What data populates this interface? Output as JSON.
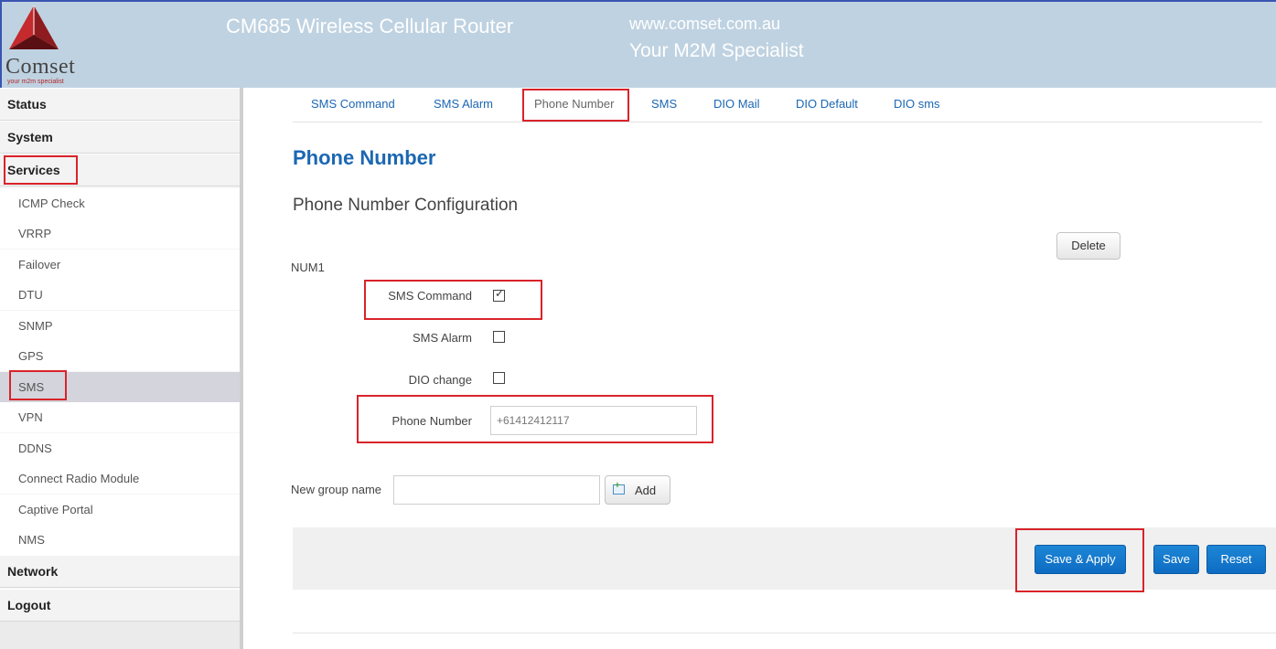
{
  "header": {
    "logo_text": "Comset",
    "logo_sub": "your m2m specialist",
    "title": "CM685 Wireless Cellular Router",
    "url": "www.comset.com.au",
    "tagline": "Your M2M Specialist"
  },
  "sidebar": {
    "status": "Status",
    "system": "System",
    "services": "Services",
    "items": [
      "ICMP Check",
      "VRRP",
      "Failover",
      "DTU",
      "SNMP",
      "GPS",
      "SMS",
      "VPN",
      "DDNS",
      "Connect Radio Module",
      "Captive Portal",
      "NMS"
    ],
    "active_item": "SMS",
    "network": "Network",
    "logout": "Logout"
  },
  "tabs": [
    "SMS Command",
    "SMS Alarm",
    "Phone Number",
    "SMS",
    "DIO Mail",
    "DIO Default",
    "DIO sms"
  ],
  "active_tab": "Phone Number",
  "main": {
    "page_title": "Phone Number",
    "section_title": "Phone Number Configuration",
    "delete_label": "Delete",
    "num_label": "NUM1",
    "fields": {
      "sms_command": {
        "label": "SMS Command",
        "checked": true
      },
      "sms_alarm": {
        "label": "SMS Alarm",
        "checked": false
      },
      "dio_change": {
        "label": "DIO change",
        "checked": false
      },
      "phone_number": {
        "label": "Phone Number",
        "value": "+61412412117"
      }
    },
    "new_group_label": "New group name",
    "new_group_value": "",
    "add_label": "Add"
  },
  "footer": {
    "save_apply": "Save & Apply",
    "save": "Save",
    "reset": "Reset"
  },
  "colors": {
    "header_bg": "#bfd2e1",
    "link_blue": "#1b67b3",
    "highlight_red": "#d9232a",
    "button_blue": "#1479c9"
  }
}
